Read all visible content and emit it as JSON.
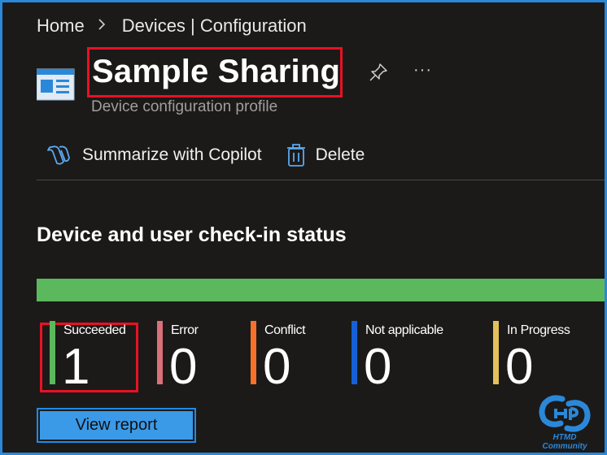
{
  "breadcrumb": [
    "Home",
    "Devices | Configuration"
  ],
  "page": {
    "title": "Sample Sharing",
    "subtitle": "Device configuration profile",
    "more": "···"
  },
  "toolbar": {
    "summarize_label": "Summarize with Copilot",
    "delete_label": "Delete"
  },
  "section": {
    "title": "Device and user check-in status"
  },
  "status_bar": {
    "color": "#5cb85c"
  },
  "stats": [
    {
      "label": "Succeeded",
      "value": "1",
      "color": "#5cb85c"
    },
    {
      "label": "Error",
      "value": "0",
      "color": "#d9707a"
    },
    {
      "label": "Conflict",
      "value": "0",
      "color": "#f7712a"
    },
    {
      "label": "Not applicable",
      "value": "0",
      "color": "#1560d6"
    },
    {
      "label": "In Progress",
      "value": "0",
      "color": "#e2c15a"
    }
  ],
  "view_report_label": "View report",
  "watermark": {
    "text": "HTMD Community"
  },
  "colors": {
    "accent": "#2b88d8",
    "highlight": "#e81123",
    "background": "#1b1a19"
  }
}
